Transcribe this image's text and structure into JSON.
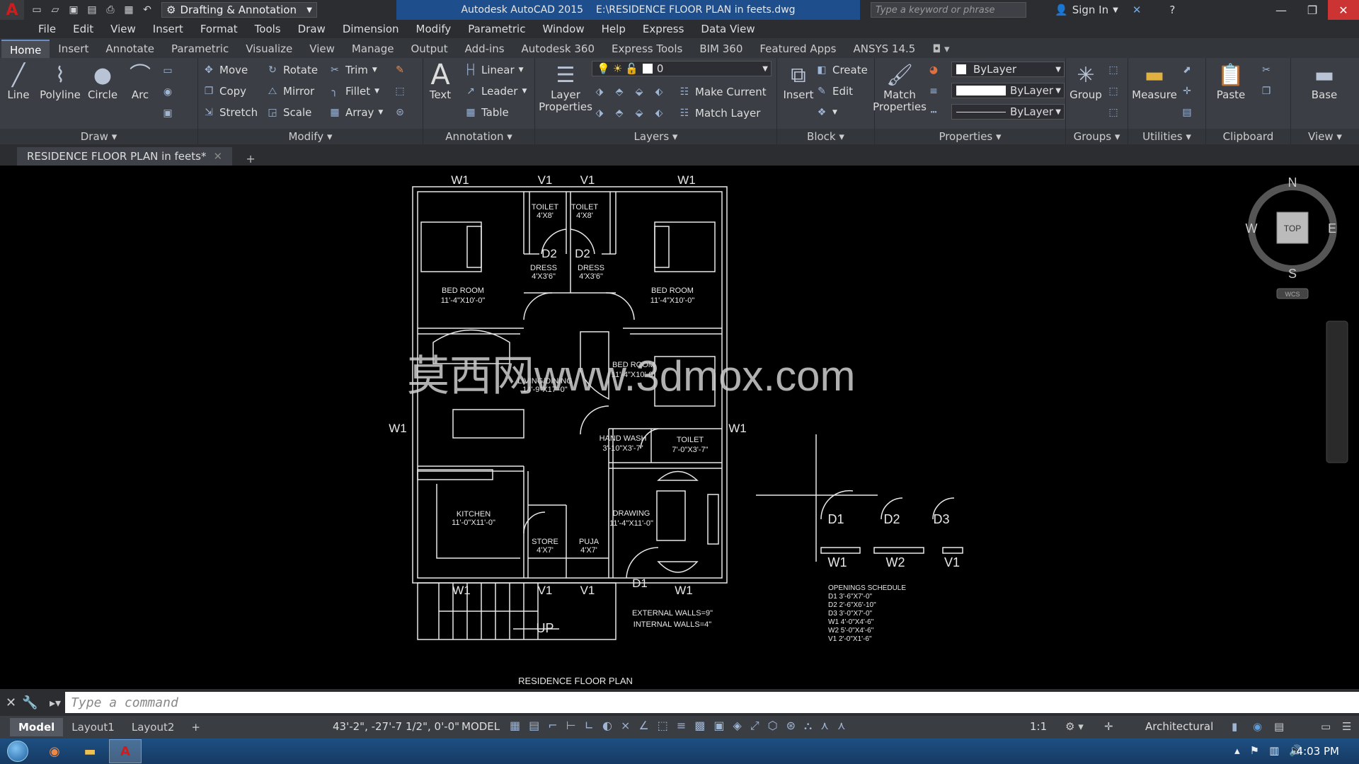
{
  "app": {
    "logo": "A",
    "workspace": "Drafting & Annotation",
    "title": "Autodesk AutoCAD 2015",
    "file_path": "E:\\RESIDENCE FLOOR PLAN in feets.dwg",
    "search_placeholder": "Type a keyword or phrase",
    "sign_in": "Sign In"
  },
  "menu": [
    "File",
    "Edit",
    "View",
    "Insert",
    "Format",
    "Tools",
    "Draw",
    "Dimension",
    "Modify",
    "Parametric",
    "Window",
    "Help",
    "Express",
    "Data View"
  ],
  "ribbon_tabs": [
    "Home",
    "Insert",
    "Annotate",
    "Parametric",
    "Visualize",
    "View",
    "Manage",
    "Output",
    "Add-ins",
    "Autodesk 360",
    "Express Tools",
    "BIM 360",
    "Featured Apps",
    "ANSYS 14.5"
  ],
  "ribbon": {
    "draw": {
      "title": "Draw",
      "line": "Line",
      "polyline": "Polyline",
      "circle": "Circle",
      "arc": "Arc"
    },
    "modify": {
      "title": "Modify",
      "move": "Move",
      "rotate": "Rotate",
      "trim": "Trim",
      "copy": "Copy",
      "mirror": "Mirror",
      "fillet": "Fillet",
      "stretch": "Stretch",
      "scale": "Scale",
      "array": "Array"
    },
    "annotation": {
      "title": "Annotation",
      "text": "Text",
      "linear": "Linear",
      "leader": "Leader",
      "table": "Table"
    },
    "layers": {
      "title": "Layers",
      "layer_properties": "Layer Properties",
      "current_layer": "0",
      "make_current": "Make Current",
      "match_layer": "Match Layer"
    },
    "block": {
      "title": "Block",
      "insert": "Insert",
      "create": "Create",
      "edit": "Edit"
    },
    "properties": {
      "title": "Properties",
      "match_properties": "Match Properties",
      "color": "ByLayer",
      "lineweight": "ByLayer",
      "linetype": "ByLayer"
    },
    "groups": {
      "title": "Groups",
      "group": "Group"
    },
    "utilities": {
      "title": "Utilities",
      "measure": "Measure"
    },
    "clipboard": {
      "title": "Clipboard",
      "paste": "Paste"
    },
    "view": {
      "title": "View",
      "base": "Base"
    }
  },
  "doc_tab": "RESIDENCE FLOOR PLAN in feets*",
  "viewcube": {
    "n": "N",
    "s": "S",
    "e": "E",
    "w": "W",
    "top": "TOP",
    "wcs": "WCS"
  },
  "drawing": {
    "title": "RESIDENCE FLOOR PLAN",
    "watermark": "莫西网www.3dmox.com",
    "labels": {
      "toilet1": "TOILET",
      "toilet1_size": "4'X8'",
      "toilet2": "TOILET",
      "toilet2_size": "4'X8'",
      "dress1": "DRESS",
      "dress1_size": "4'X3'6\"",
      "dress2": "DRESS",
      "dress2_size": "4'X3'6\"",
      "bed1": "BED ROOM",
      "bed1_size": "11'-4\"X10'-0\"",
      "bed2": "BED ROOM",
      "bed2_size": "11'-4\"X10'-0\"",
      "bed3": "BED ROOM",
      "bed3_size": "11'-4\"X10'-0\"",
      "living": "LIVING/DINING",
      "living_size": "14'-9\"X17'-0\"",
      "handwash": "HAND WASH",
      "handwash_size": "3'-10\"X3'-7\"",
      "toilet3": "TOILET",
      "toilet3_size": "7'-0\"X3'-7\"",
      "kitchen": "KITCHEN",
      "kitchen_size": "11'-0\"X11'-0\"",
      "store": "STORE",
      "store_size": "4'X7'",
      "puja": "PUJA",
      "puja_size": "4'X7'",
      "drawing_room": "DRAWING",
      "drawing_size": "11'-4\"X11'-0\"",
      "up": "UP",
      "walls1": "EXTERNAL WALLS=9\"",
      "walls2": "INTERNAL WALLS=4\""
    },
    "openings": [
      "W1",
      "W2",
      "V1",
      "D1",
      "D2",
      "D3"
    ],
    "schedule": {
      "title": "OPENINGS SCHEDULE",
      "rows": [
        "D1  3'-6\"X7'-0\"",
        "D2  2'-6\"X6'-10\"",
        "D3  3'-0\"X7'-0\"",
        "W1  4'-0\"X4'-6\"",
        "W2  5'-0\"X4'-6\"",
        "V1  2'-0\"X1'-6\""
      ]
    }
  },
  "command": {
    "placeholder": "Type a command"
  },
  "status": {
    "layouts": [
      "Model",
      "Layout1",
      "Layout2"
    ],
    "coords": "43'-2\", -27'-7 1/2\", 0'-0\"",
    "model": "MODEL",
    "scale": "1:1",
    "units": "Architectural"
  },
  "taskbar": {
    "time": "4:03 PM"
  },
  "colors": {
    "titlebar_blue": "#1e4e8c",
    "ribbon": "#3b3e44",
    "canvas": "#000000",
    "drawing_lines": "#e8e8e8",
    "close": "#cc3333"
  }
}
